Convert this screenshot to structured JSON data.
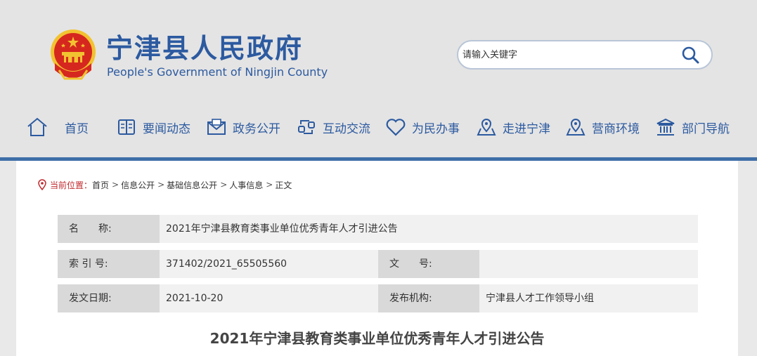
{
  "site": {
    "title": "宁津县人民政府",
    "subtitle": "People's Government of Ningjin County"
  },
  "search": {
    "placeholder": "请输入关键字"
  },
  "nav": {
    "items": [
      {
        "label": "首页",
        "icon": "home-icon"
      },
      {
        "label": "要闻动态",
        "icon": "news-book-icon"
      },
      {
        "label": "政务公开",
        "icon": "envelope-icon"
      },
      {
        "label": "互动交流",
        "icon": "exchange-icon"
      },
      {
        "label": "为民办事",
        "icon": "heart-icon"
      },
      {
        "label": "走进宁津",
        "icon": "location-map-icon"
      },
      {
        "label": "营商环境",
        "icon": "location-map-icon"
      },
      {
        "label": "部门导航",
        "icon": "building-icon"
      }
    ]
  },
  "breadcrumb": {
    "lead": "当前位置：",
    "items": [
      "首页",
      "信息公开",
      "基础信息公开",
      "人事信息",
      "正文"
    ],
    "separator": ">"
  },
  "info": {
    "name_label": "名　　称:",
    "name_value": "2021年宁津县教育类事业单位优秀青年人才引进公告",
    "index_label": "索 引 号:",
    "index_value": "371402/2021_65505560",
    "docno_label": "文　　号:",
    "docno_value": "",
    "date_label": "发文日期:",
    "date_value": "2021-10-20",
    "org_label": "发布机构:",
    "org_value": "宁津县人才工作领导小组"
  },
  "article": {
    "title": "2021年宁津县教育类事业单位优秀青年人才引进公告"
  },
  "colors": {
    "brand_blue": "#2c5aa0",
    "header_bg": "#e4e4e4",
    "header_line": "#3e6ea8",
    "label_bg": "#d9d9d9",
    "row_bg": "#f1f1f1",
    "emblem_red": "#d6271f",
    "emblem_gold": "#f2c230"
  }
}
